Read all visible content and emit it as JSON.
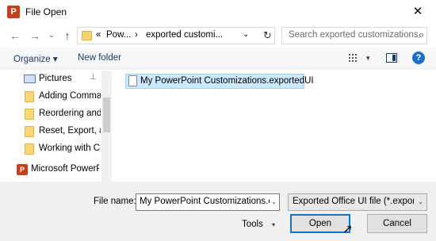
{
  "window": {
    "title": "File Open",
    "icon": "powerpoint-icon",
    "close_glyph": "✕"
  },
  "nav": {
    "back": "←",
    "forward": "→",
    "history": "⌄",
    "up": "↑",
    "breadcrumb_prefix": "«",
    "crumb1": "Pow...",
    "crumb_sep": "›",
    "crumb2": "exported customi...",
    "address_dropdown": "⌄",
    "refresh": "↻",
    "search_placeholder": "Search exported customizations",
    "search_glyph": "⌕"
  },
  "toolbar": {
    "organize": "Organize ▾",
    "new_folder": "New folder",
    "view_dropdown": "▾",
    "help": "?"
  },
  "sidebar": {
    "items": [
      {
        "label": "Pictures",
        "icon": "pictures-icon",
        "pinned": true
      },
      {
        "label": "Adding Comma",
        "icon": "folder-icon"
      },
      {
        "label": "Reordering and I",
        "icon": "folder-icon"
      },
      {
        "label": "Reset, Export, an",
        "icon": "folder-icon"
      },
      {
        "label": "Working with Cu",
        "icon": "folder-icon"
      },
      {
        "label": "Microsoft PowerP",
        "icon": "powerpoint-icon"
      }
    ],
    "pin_glyph": "📌"
  },
  "files": [
    {
      "name": "My PowerPoint Customizations.exportedUI",
      "selected": true
    }
  ],
  "footer": {
    "file_name_label": "File name:",
    "file_name_value": "My PowerPoint Customizations.exportedUI",
    "file_type": "Exported Office UI file (*.exportedUI)",
    "tools_label": "Tools",
    "open_label": "Open",
    "cancel_label": "Cancel",
    "dropdown_glyph": "▾",
    "small_dropdown_glyph": "⌄"
  },
  "colors": {
    "accent": "#0078d7",
    "selection": "#cce8ff",
    "folder": "#f8d775",
    "powerpoint": "#c43e1c"
  }
}
